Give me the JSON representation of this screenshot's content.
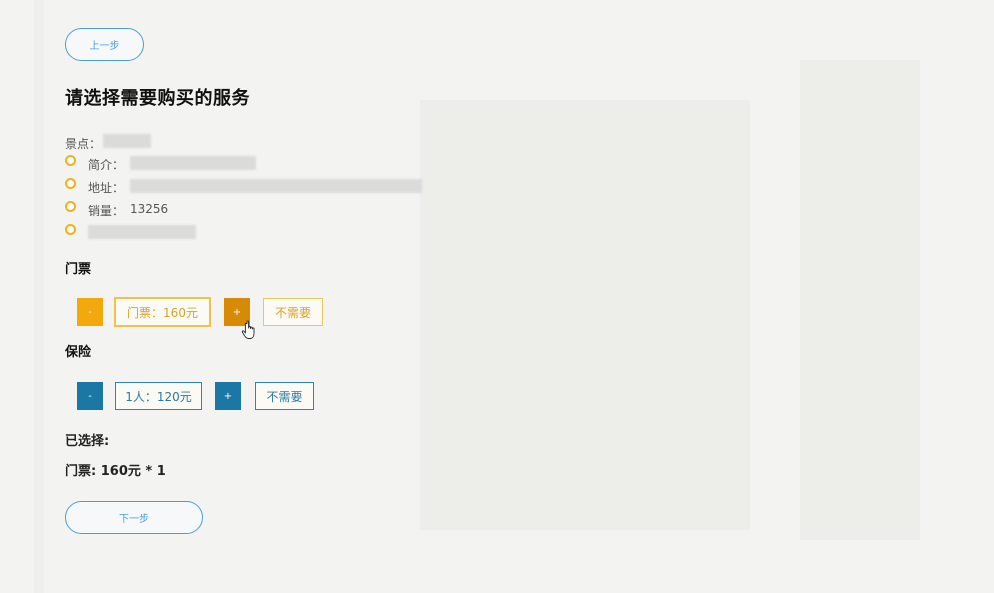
{
  "nav": {
    "prev_label": "上一步",
    "next_label": "下一步"
  },
  "page_title": "请选择需要购买的服务",
  "attraction": {
    "spot_label": "景点：",
    "intro_label": "简介：",
    "address_label": "地址：",
    "sales_label": "销量：",
    "sales_value": "13256"
  },
  "ticket": {
    "section_title": "门票",
    "minus_label": "-",
    "value_label": "门票：160元",
    "plus_label": "+",
    "none_label": "不需要"
  },
  "insurance": {
    "section_title": "保险",
    "minus_label": "-",
    "value_label": "1人：120元",
    "plus_label": "+",
    "none_label": "不需要"
  },
  "selection": {
    "header": "已选择:",
    "item": "门票: 160元 * 1"
  },
  "colors": {
    "accent_orange": "#f3a80e",
    "accent_blue": "#1b77a4",
    "link_blue": "#4a9ed8"
  },
  "icons": {
    "cursor": "hand-pointer-icon",
    "bullet": "circle-bullet-icon"
  }
}
